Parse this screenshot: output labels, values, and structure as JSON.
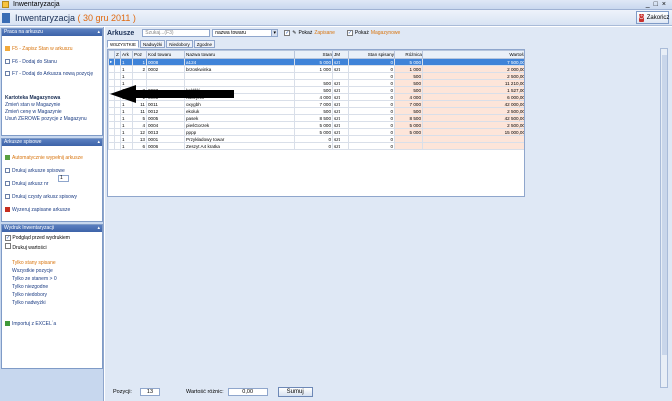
{
  "window": {
    "title": "Inwentaryzacja",
    "controls": [
      "_",
      "□",
      "×"
    ]
  },
  "header": {
    "title": "Inwentaryzacja ",
    "date": "( 30 gru 2011 )",
    "close_label": "Zakończ"
  },
  "sidebar": {
    "panel1": {
      "title": "Praca na arkuszu",
      "items": [
        {
          "label": "F5 - Zapisz Stan w arkuszu",
          "style": "orange"
        },
        {
          "label": "F6 - Dodaj do Stanu",
          "style": "blue"
        },
        {
          "label": "F7 - Dodaj do Arkusza nową pozycję",
          "style": "blue"
        }
      ],
      "card_title": "Kartoteka Magazynowa",
      "card_items": [
        "Zmień stan w Magazynie",
        "Zmień cenę w Magazynie",
        "Usuń ZEROWE pozycje z Magazynu"
      ]
    },
    "panel2": {
      "title": "Arkusze spisowe",
      "items": [
        {
          "label": "Automatycznie wypełnij arkusze",
          "style": "orange"
        },
        {
          "label": "Drukuj arkusze spisowe",
          "style": "blue"
        },
        {
          "label": "Drukuj arkusz nr",
          "style": "blue",
          "spinner": "1"
        },
        {
          "label": "Drukuj czysty arkusz spisowy",
          "style": "blue"
        },
        {
          "label": "Wyzeruj zapisane arkusze",
          "style": "blue"
        }
      ]
    },
    "panel3": {
      "title": "Wydruk Inwentaryzacji",
      "checks": [
        {
          "label": "Podgląd przed wydrukiem",
          "checked": true
        },
        {
          "label": "Drukuj wartości",
          "checked": false
        }
      ],
      "filters": [
        {
          "label": "Tylko stany spisane",
          "style": "orange"
        },
        {
          "label": "Wszystkie  pozycje",
          "style": "blue"
        },
        {
          "label": "Tylko ze stanem > 0",
          "style": "blue"
        },
        {
          "label": "Tylko niezgodne",
          "style": "blue"
        },
        {
          "label": "Tylko niedobory",
          "style": "blue"
        },
        {
          "label": "Tylko  nadwyżki",
          "style": "blue"
        }
      ],
      "import_label": "Importuj z EXCEL`a"
    }
  },
  "toolbar": {
    "label": "Arkusze",
    "search_placeholder": "Szukaj...(F3)",
    "select_value": "nazwa towaru",
    "opt1_label": "Pokaż",
    "opt1_accent": "Zapisane",
    "opt2_label": "Pokaż",
    "opt2_accent": "Magazynowe"
  },
  "tabs": [
    "WSZYSTKIE",
    "Nadwyżki",
    "Niedobory",
    "Zgodne"
  ],
  "table": {
    "columns": [
      "Z",
      "Ark",
      "Poz",
      "Kod towaru",
      "Nazwa towaru",
      "Stan",
      "JM",
      "Stan spisany",
      "Różnica",
      "Wartość"
    ],
    "rows": [
      [
        "",
        "1",
        "1",
        "0008",
        "a124",
        "5 000",
        "szt",
        "0",
        "5 000",
        "7 500,00"
      ],
      [
        "",
        "1",
        "2",
        "0002",
        "brzoskwinka",
        "1 000",
        "szt",
        "0",
        "1 000",
        "2 000,00"
      ],
      [
        "",
        "1",
        "",
        "",
        "",
        "",
        "",
        "0",
        "500",
        "2 500,00"
      ],
      [
        "",
        "1",
        "",
        "",
        "",
        "500",
        "szt",
        "0",
        "500",
        "11 210,00"
      ],
      [
        "",
        "1",
        "3",
        "0003",
        "kołdźki",
        "500",
        "szt",
        "0",
        "500",
        "1 527,00"
      ],
      [
        "",
        "1",
        "1",
        "0001",
        "naczynik",
        "4 000",
        "szt",
        "0",
        "4 000",
        "6 000,00"
      ],
      [
        "",
        "1",
        "11",
        "0011",
        "oxygbh",
        "7 000",
        "szt",
        "0",
        "7 000",
        "42 000,00"
      ],
      [
        "",
        "1",
        "11",
        "0012",
        "ekoluk",
        "500",
        "szt",
        "0",
        "500",
        "2 500,00"
      ],
      [
        "",
        "1",
        "5",
        "0005",
        "pasek",
        "8 500",
        "szt",
        "0",
        "8 500",
        "42 500,00"
      ],
      [
        "",
        "1",
        "4",
        "0004",
        "pieśGorzek",
        "5 000",
        "szt",
        "0",
        "5 000",
        "2 500,00"
      ],
      [
        "",
        "1",
        "12",
        "0013",
        "pppp",
        "5 000",
        "szt",
        "0",
        "5 000",
        "15 000,00"
      ],
      [
        "",
        "1",
        "13",
        "0001",
        "Przykładowy towar",
        "0",
        "szt",
        "0",
        "",
        ""
      ],
      [
        "",
        "1",
        "6",
        "0006",
        "Zeszyt A4 kratka",
        "0",
        "szt",
        "0",
        "",
        ""
      ]
    ]
  },
  "footer": {
    "count_label": "Pozycji:",
    "count_value": "13",
    "diff_label": "Wartość różnic:",
    "diff_value": "0,00",
    "sum_button": "Sumuj"
  },
  "colors": {
    "accent_orange": "#d8740d",
    "selection_blue": "#3f83d8",
    "panel_header": "#3d63a8"
  }
}
